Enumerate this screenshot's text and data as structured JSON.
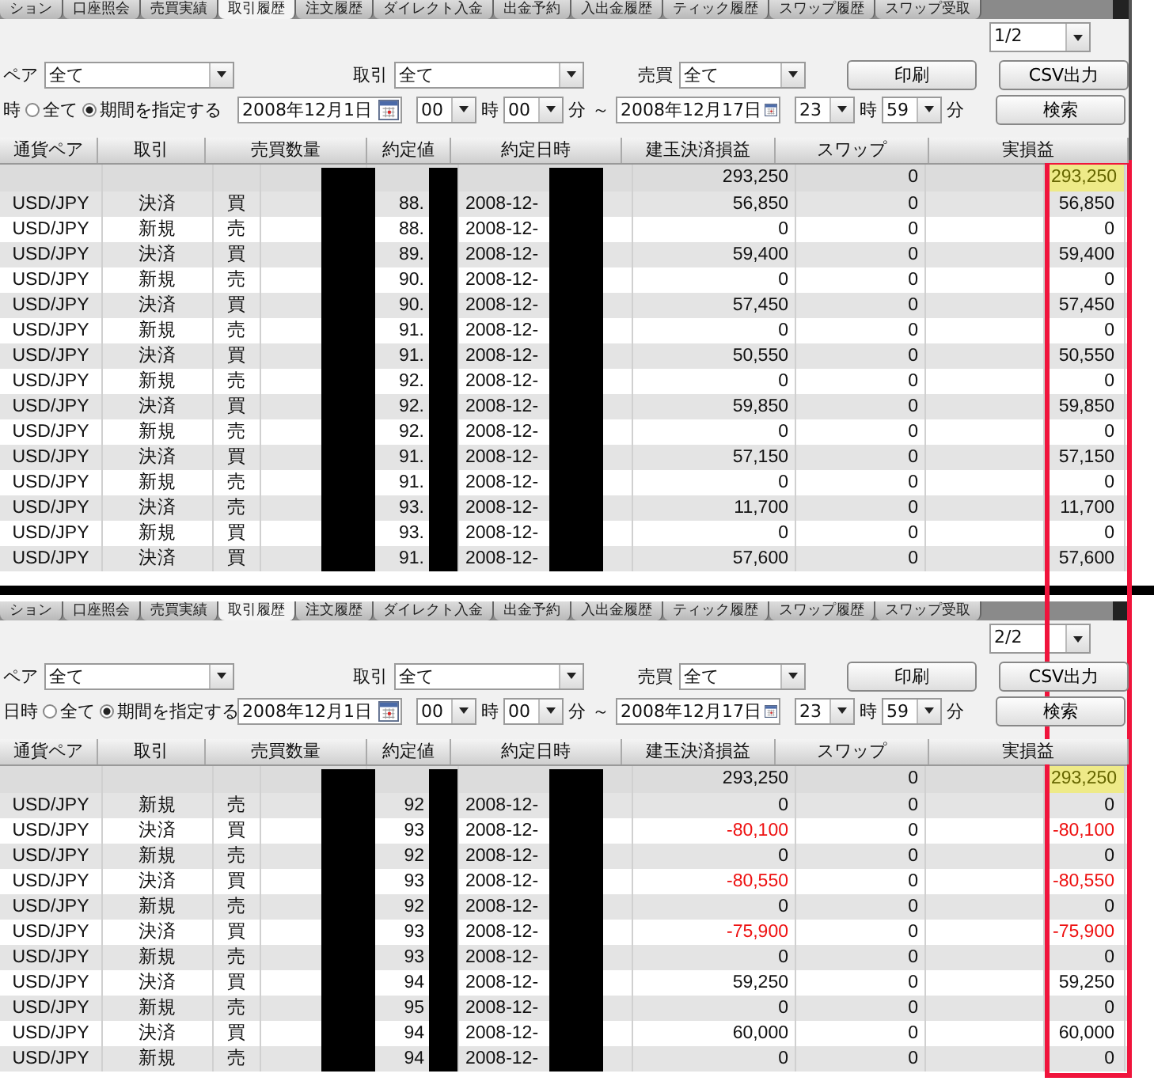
{
  "highlight_frame": true,
  "panels": [
    {
      "tabs": [
        {
          "label": "ション",
          "selected": false
        },
        {
          "label": "口座照会",
          "selected": false
        },
        {
          "label": "売買実績",
          "selected": false
        },
        {
          "label": "取引履歴",
          "selected": true
        },
        {
          "label": "注文履歴",
          "selected": false
        },
        {
          "label": "ダイレクト入金",
          "selected": false
        },
        {
          "label": "出金予約",
          "selected": false
        },
        {
          "label": "入出金履歴",
          "selected": false
        },
        {
          "label": "ティック履歴",
          "selected": false
        },
        {
          "label": "スワップ履歴",
          "selected": false
        },
        {
          "label": "スワップ受取",
          "selected": false
        }
      ],
      "page": "1/2",
      "filters": {
        "pair_label": "ペア",
        "pair_value": "全て",
        "trade_label": "取引",
        "trade_value": "全て",
        "side_label": "売買",
        "side_value": "全て"
      },
      "period": {
        "label": "時",
        "radios": [
          {
            "label": "全て",
            "selected": false
          },
          {
            "label": "期間を指定する",
            "selected": true
          }
        ],
        "from": {
          "date": "2008年12月1日",
          "hour": "00",
          "hour_unit": "時",
          "minute": "00",
          "minute_unit": "分"
        },
        "separator": "～",
        "to": {
          "date": "2008年12月17日",
          "hour": "23",
          "hour_unit": "時",
          "minute": "59",
          "minute_unit": "分"
        }
      },
      "buttons": {
        "print": "印刷",
        "csv": "CSV出力",
        "search": "検索"
      },
      "columns": [
        "通貨ペア",
        "取引",
        "売買数量",
        "約定値",
        "約定日時",
        "建玉決済損益",
        "スワップ",
        "実損益"
      ],
      "total": {
        "pnl": "293,250",
        "swap": "0",
        "real": "293,250",
        "highlighted": true
      },
      "redacted": true,
      "rows": [
        {
          "pair": "USD/JPY",
          "trade": "決済",
          "side": "買",
          "rate": "88.",
          "date": "2008-12-",
          "pnl": "56,850",
          "swap": "0",
          "real": "56,850",
          "loss": false
        },
        {
          "pair": "USD/JPY",
          "trade": "新規",
          "side": "売",
          "rate": "88.",
          "date": "2008-12-",
          "pnl": "0",
          "swap": "0",
          "real": "0",
          "loss": false
        },
        {
          "pair": "USD/JPY",
          "trade": "決済",
          "side": "買",
          "rate": "89.",
          "date": "2008-12-",
          "pnl": "59,400",
          "swap": "0",
          "real": "59,400",
          "loss": false
        },
        {
          "pair": "USD/JPY",
          "trade": "新規",
          "side": "売",
          "rate": "90.",
          "date": "2008-12-",
          "pnl": "0",
          "swap": "0",
          "real": "0",
          "loss": false
        },
        {
          "pair": "USD/JPY",
          "trade": "決済",
          "side": "買",
          "rate": "90.",
          "date": "2008-12-",
          "pnl": "57,450",
          "swap": "0",
          "real": "57,450",
          "loss": false
        },
        {
          "pair": "USD/JPY",
          "trade": "新規",
          "side": "売",
          "rate": "91.",
          "date": "2008-12-",
          "pnl": "0",
          "swap": "0",
          "real": "0",
          "loss": false
        },
        {
          "pair": "USD/JPY",
          "trade": "決済",
          "side": "買",
          "rate": "91.",
          "date": "2008-12-",
          "pnl": "50,550",
          "swap": "0",
          "real": "50,550",
          "loss": false
        },
        {
          "pair": "USD/JPY",
          "trade": "新規",
          "side": "売",
          "rate": "92.",
          "date": "2008-12-",
          "pnl": "0",
          "swap": "0",
          "real": "0",
          "loss": false
        },
        {
          "pair": "USD/JPY",
          "trade": "決済",
          "side": "買",
          "rate": "92.",
          "date": "2008-12-",
          "pnl": "59,850",
          "swap": "0",
          "real": "59,850",
          "loss": false
        },
        {
          "pair": "USD/JPY",
          "trade": "新規",
          "side": "売",
          "rate": "92.",
          "date": "2008-12-",
          "pnl": "0",
          "swap": "0",
          "real": "0",
          "loss": false
        },
        {
          "pair": "USD/JPY",
          "trade": "決済",
          "side": "買",
          "rate": "91.",
          "date": "2008-12-",
          "pnl": "57,150",
          "swap": "0",
          "real": "57,150",
          "loss": false
        },
        {
          "pair": "USD/JPY",
          "trade": "新規",
          "side": "売",
          "rate": "91.",
          "date": "2008-12-",
          "pnl": "0",
          "swap": "0",
          "real": "0",
          "loss": false
        },
        {
          "pair": "USD/JPY",
          "trade": "決済",
          "side": "売",
          "rate": "93.",
          "date": "2008-12-",
          "pnl": "11,700",
          "swap": "0",
          "real": "11,700",
          "loss": false
        },
        {
          "pair": "USD/JPY",
          "trade": "新規",
          "side": "買",
          "rate": "93.",
          "date": "2008-12-",
          "pnl": "0",
          "swap": "0",
          "real": "0",
          "loss": false
        },
        {
          "pair": "USD/JPY",
          "trade": "決済",
          "side": "買",
          "rate": "91.",
          "date": "2008-12-",
          "pnl": "57,600",
          "swap": "0",
          "real": "57,600",
          "loss": false
        }
      ]
    },
    {
      "tabs": [
        {
          "label": "ション",
          "selected": false
        },
        {
          "label": "口座照会",
          "selected": false
        },
        {
          "label": "売買実績",
          "selected": false
        },
        {
          "label": "取引履歴",
          "selected": true
        },
        {
          "label": "注文履歴",
          "selected": false
        },
        {
          "label": "ダイレクト入金",
          "selected": false
        },
        {
          "label": "出金予約",
          "selected": false
        },
        {
          "label": "入出金履歴",
          "selected": false
        },
        {
          "label": "ティック履歴",
          "selected": false
        },
        {
          "label": "スワップ履歴",
          "selected": false
        },
        {
          "label": "スワップ受取",
          "selected": false
        }
      ],
      "page": "2/2",
      "filters": {
        "pair_label": "ペア",
        "pair_value": "全て",
        "trade_label": "取引",
        "trade_value": "全て",
        "side_label": "売買",
        "side_value": "全て"
      },
      "period": {
        "label": "日時",
        "radios": [
          {
            "label": "全て",
            "selected": false
          },
          {
            "label": "期間を指定する",
            "selected": true
          }
        ],
        "from": {
          "date": "2008年12月1日",
          "hour": "00",
          "hour_unit": "時",
          "minute": "00",
          "minute_unit": "分"
        },
        "separator": "～",
        "to": {
          "date": "2008年12月17日",
          "hour": "23",
          "hour_unit": "時",
          "minute": "59",
          "minute_unit": "分"
        }
      },
      "buttons": {
        "print": "印刷",
        "csv": "CSV出力",
        "search": "検索"
      },
      "columns": [
        "通貨ペア",
        "取引",
        "売買数量",
        "約定値",
        "約定日時",
        "建玉決済損益",
        "スワップ",
        "実損益"
      ],
      "total": {
        "pnl": "293,250",
        "swap": "0",
        "real": "293,250",
        "highlighted": true
      },
      "redacted": true,
      "rows": [
        {
          "pair": "USD/JPY",
          "trade": "新規",
          "side": "売",
          "rate": "92",
          "date": "2008-12-",
          "pnl": "0",
          "swap": "0",
          "real": "0",
          "loss": false
        },
        {
          "pair": "USD/JPY",
          "trade": "決済",
          "side": "買",
          "rate": "93",
          "date": "2008-12-",
          "pnl": "-80,100",
          "swap": "0",
          "real": "-80,100",
          "loss": true
        },
        {
          "pair": "USD/JPY",
          "trade": "新規",
          "side": "売",
          "rate": "92",
          "date": "2008-12-",
          "pnl": "0",
          "swap": "0",
          "real": "0",
          "loss": false
        },
        {
          "pair": "USD/JPY",
          "trade": "決済",
          "side": "買",
          "rate": "93",
          "date": "2008-12-",
          "pnl": "-80,550",
          "swap": "0",
          "real": "-80,550",
          "loss": true
        },
        {
          "pair": "USD/JPY",
          "trade": "新規",
          "side": "売",
          "rate": "92",
          "date": "2008-12-",
          "pnl": "0",
          "swap": "0",
          "real": "0",
          "loss": false
        },
        {
          "pair": "USD/JPY",
          "trade": "決済",
          "side": "買",
          "rate": "93",
          "date": "2008-12-",
          "pnl": "-75,900",
          "swap": "0",
          "real": "-75,900",
          "loss": true
        },
        {
          "pair": "USD/JPY",
          "trade": "新規",
          "side": "売",
          "rate": "93",
          "date": "2008-12-",
          "pnl": "0",
          "swap": "0",
          "real": "0",
          "loss": false
        },
        {
          "pair": "USD/JPY",
          "trade": "決済",
          "side": "買",
          "rate": "94",
          "date": "2008-12-",
          "pnl": "59,250",
          "swap": "0",
          "real": "59,250",
          "loss": false
        },
        {
          "pair": "USD/JPY",
          "trade": "新規",
          "side": "売",
          "rate": "95",
          "date": "2008-12-",
          "pnl": "0",
          "swap": "0",
          "real": "0",
          "loss": false
        },
        {
          "pair": "USD/JPY",
          "trade": "決済",
          "side": "買",
          "rate": "94",
          "date": "2008-12-",
          "pnl": "60,000",
          "swap": "0",
          "real": "60,000",
          "loss": false
        },
        {
          "pair": "USD/JPY",
          "trade": "新規",
          "side": "売",
          "rate": "94",
          "date": "2008-12-",
          "pnl": "0",
          "swap": "0",
          "real": "0",
          "loss": false
        }
      ]
    }
  ]
}
